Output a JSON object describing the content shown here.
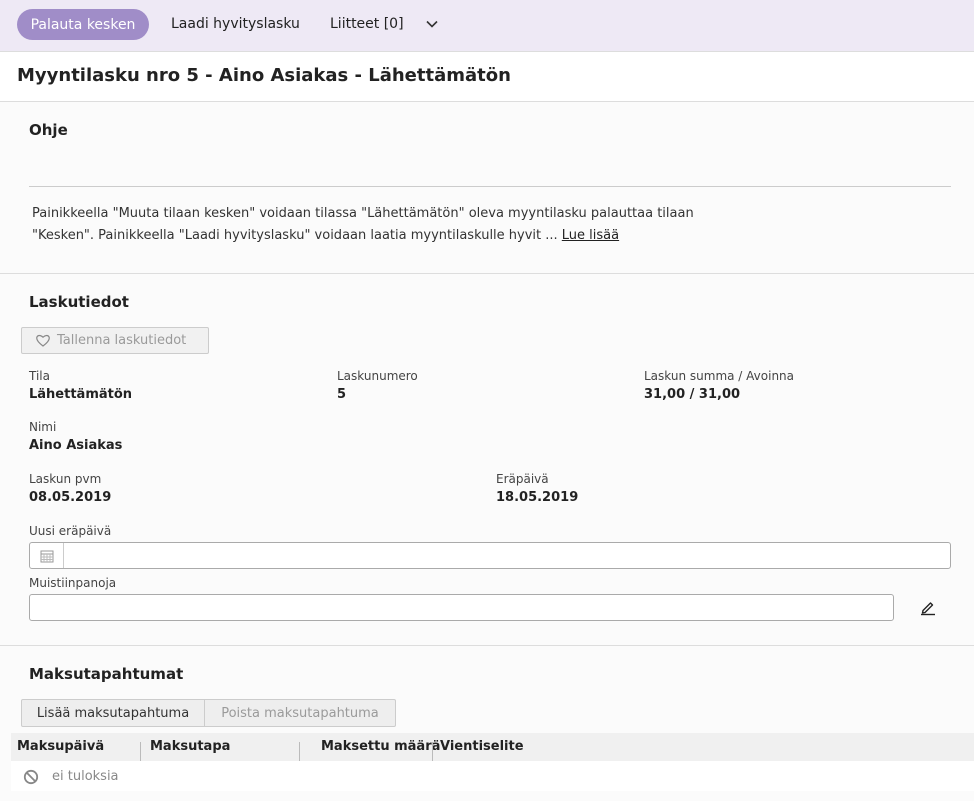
{
  "toolbar": {
    "primary_button": "Palauta kesken",
    "credit_button": "Laadi hyvityslasku",
    "attachments": "Liitteet [0]",
    "more_icon": "chevron-down-icon"
  },
  "page_title": "Myyntilasku nro 5 - Aino Asiakas - Lähettämätön",
  "ohje": {
    "title": "Ohje",
    "line1": "Painikkeella \"Muuta tilaan kesken\" voidaan tilassa \"Lähettämätön\" oleva myyntilasku palauttaa tilaan",
    "line2": "\"Kesken\". Painikkeella \"Laadi hyvityslasku\" voidaan laatia myyntilaskulle hyvit ... ",
    "read_more": "Lue lisää"
  },
  "laskutiedot": {
    "title": "Laskutiedot",
    "save_button": "Tallenna laskutiedot",
    "save_icon": "heart-icon",
    "fields": {
      "tila": {
        "label": "Tila",
        "value": "Lähettämätön"
      },
      "laskunumero": {
        "label": "Laskunumero",
        "value": "5"
      },
      "summa": {
        "label": "Laskun summa / Avoinna",
        "value": "31,00 / 31,00"
      },
      "nimi": {
        "label": "Nimi",
        "value": "Aino Asiakas"
      },
      "pvm": {
        "label": "Laskun pvm",
        "value": "08.05.2019"
      },
      "erapaiva": {
        "label": "Eräpäivä",
        "value": "18.05.2019"
      }
    },
    "new_due_date": {
      "label": "Uusi eräpäivä",
      "value": "",
      "icon": "calendar-icon"
    },
    "notes": {
      "label": "Muistiinpanoja",
      "value": "",
      "icon": "pencil-icon"
    }
  },
  "maksutapahtumat": {
    "title": "Maksutapahtumat",
    "add_button": "Lisää maksutapahtuma",
    "delete_button": "Poista maksutapahtuma",
    "columns": [
      "Maksupäivä",
      "Maksutapa",
      "Maksettu määrä",
      "Vientiselite"
    ],
    "empty_text": "ei tuloksia",
    "empty_icon": "ban-icon"
  },
  "colors": {
    "accent": "#a08dc8",
    "toolbar_bg": "#eee9f5"
  }
}
